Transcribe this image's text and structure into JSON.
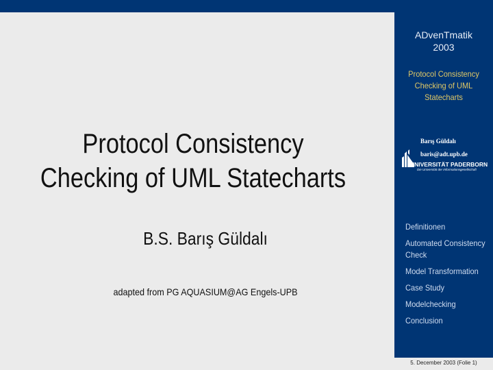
{
  "sidebar": {
    "conference": "ADvenTmatik",
    "year": "2003",
    "talk_title_lines": [
      "Protocol Consistency",
      "Checking of UML",
      "Statecharts"
    ],
    "author_name": "Barış Güldalı",
    "author_email": "baris@adt.upb.de",
    "logo": {
      "name": "UNIVERSITÄT PADERBORN",
      "tagline": "Die Universität der Informationsgesellschaft"
    },
    "nav_items": [
      {
        "label": "Definitionen"
      },
      {
        "label": "Automated Consistency Check"
      },
      {
        "label": "Model Transformation"
      },
      {
        "label": "Case Study"
      },
      {
        "label": "Modelchecking"
      },
      {
        "label": "Conclusion"
      }
    ]
  },
  "footer": {
    "date_slide": "5. December 2003 (Folie 1)"
  },
  "main": {
    "title_lines": [
      "Protocol Consistency",
      "Checking of UML Statecharts"
    ],
    "presenter": "B.S. Barış Güldalı",
    "adapted_from": "adapted from PG AQUASIUM@AG Engels-UPB"
  },
  "colors": {
    "brand_blue": "#003574",
    "accent_gold": "#e0c866",
    "background": "#ebebeb"
  }
}
